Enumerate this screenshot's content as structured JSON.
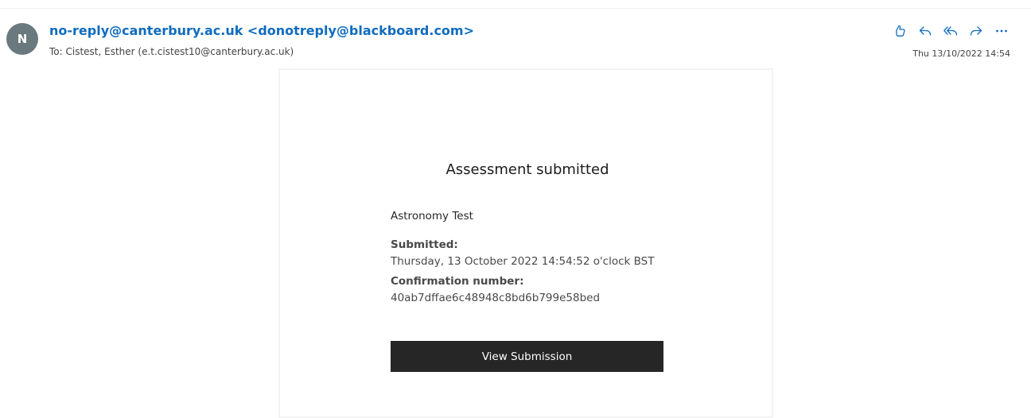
{
  "header": {
    "avatar_initial": "N",
    "sender": "no-reply@canterbury.ac.uk <donotreply@blackboard.com>",
    "to": "To: Cistest, Esther (e.t.cistest10@canterbury.ac.uk)",
    "timestamp": "Thu 13/10/2022 14:54",
    "actions": {
      "like_icon": "thumbs-up-icon",
      "reply_icon": "reply-icon",
      "reply_all_icon": "reply-all-icon",
      "forward_icon": "forward-icon",
      "more_icon": "more-icon"
    },
    "accent_color": "#0f6cbd",
    "avatar_color": "#69797e"
  },
  "email": {
    "title": "Assessment submitted",
    "test_name": "Astronomy Test",
    "submitted_label": "Submitted:",
    "submitted_value": "Thursday, 13 October 2022 14:54:52 o'clock BST",
    "confirmation_label": "Confirmation number:",
    "confirmation_value": "40ab7dffae6c48948c8bd6b799e58bed",
    "button_label": "View Submission",
    "button_color": "#262626"
  }
}
